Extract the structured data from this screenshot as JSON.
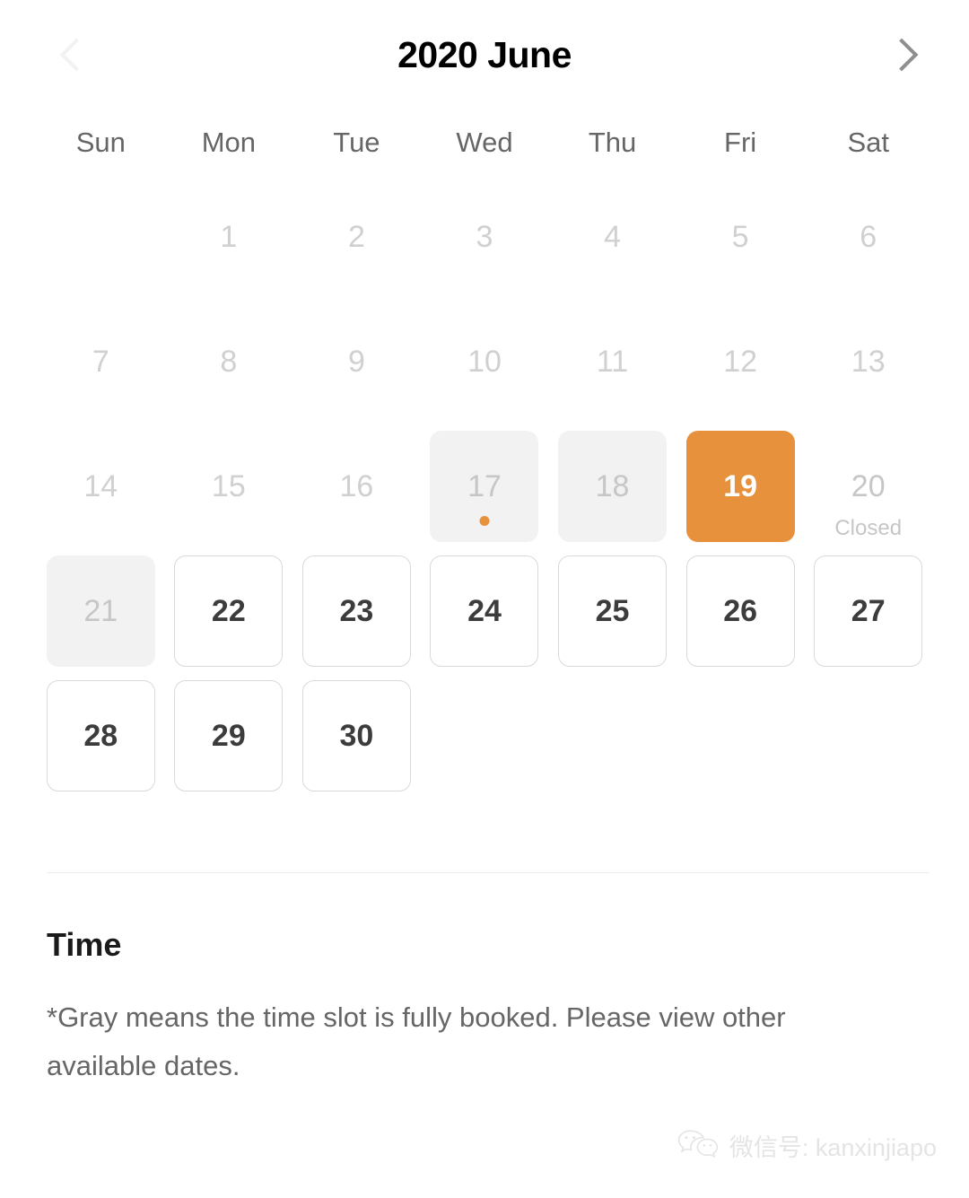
{
  "header": {
    "title": "2020 June",
    "prev_icon": "chevron-left-icon",
    "next_icon": "chevron-right-icon"
  },
  "weekdays": [
    "Sun",
    "Mon",
    "Tue",
    "Wed",
    "Thu",
    "Fri",
    "Sat"
  ],
  "calendar": {
    "leading_blanks": 1,
    "days": [
      {
        "num": "1",
        "state": "past"
      },
      {
        "num": "2",
        "state": "past"
      },
      {
        "num": "3",
        "state": "past"
      },
      {
        "num": "4",
        "state": "past"
      },
      {
        "num": "5",
        "state": "past"
      },
      {
        "num": "6",
        "state": "past"
      },
      {
        "num": "7",
        "state": "past"
      },
      {
        "num": "8",
        "state": "past"
      },
      {
        "num": "9",
        "state": "past"
      },
      {
        "num": "10",
        "state": "past"
      },
      {
        "num": "11",
        "state": "past"
      },
      {
        "num": "12",
        "state": "past"
      },
      {
        "num": "13",
        "state": "past"
      },
      {
        "num": "14",
        "state": "past"
      },
      {
        "num": "15",
        "state": "past"
      },
      {
        "num": "16",
        "state": "past"
      },
      {
        "num": "17",
        "state": "booked",
        "dot": true
      },
      {
        "num": "18",
        "state": "booked"
      },
      {
        "num": "19",
        "state": "selected"
      },
      {
        "num": "20",
        "state": "closed",
        "label": "Closed"
      },
      {
        "num": "21",
        "state": "booked"
      },
      {
        "num": "22",
        "state": "available"
      },
      {
        "num": "23",
        "state": "available"
      },
      {
        "num": "24",
        "state": "available"
      },
      {
        "num": "25",
        "state": "available"
      },
      {
        "num": "26",
        "state": "available"
      },
      {
        "num": "27",
        "state": "available"
      },
      {
        "num": "28",
        "state": "available"
      },
      {
        "num": "29",
        "state": "available"
      },
      {
        "num": "30",
        "state": "available"
      }
    ]
  },
  "time_section": {
    "heading": "Time",
    "note": "*Gray means the time slot is fully booked. Please view other available dates."
  },
  "watermark": {
    "icon": "wechat-icon",
    "text": "微信号: kanxinjiapo"
  },
  "colors": {
    "accent_orange": "#e8913c",
    "booked_gray": "#f2f2f2",
    "border_gray": "#d9d9d9",
    "text_dark": "#3c3c3c",
    "text_muted": "#c6c6c6"
  }
}
